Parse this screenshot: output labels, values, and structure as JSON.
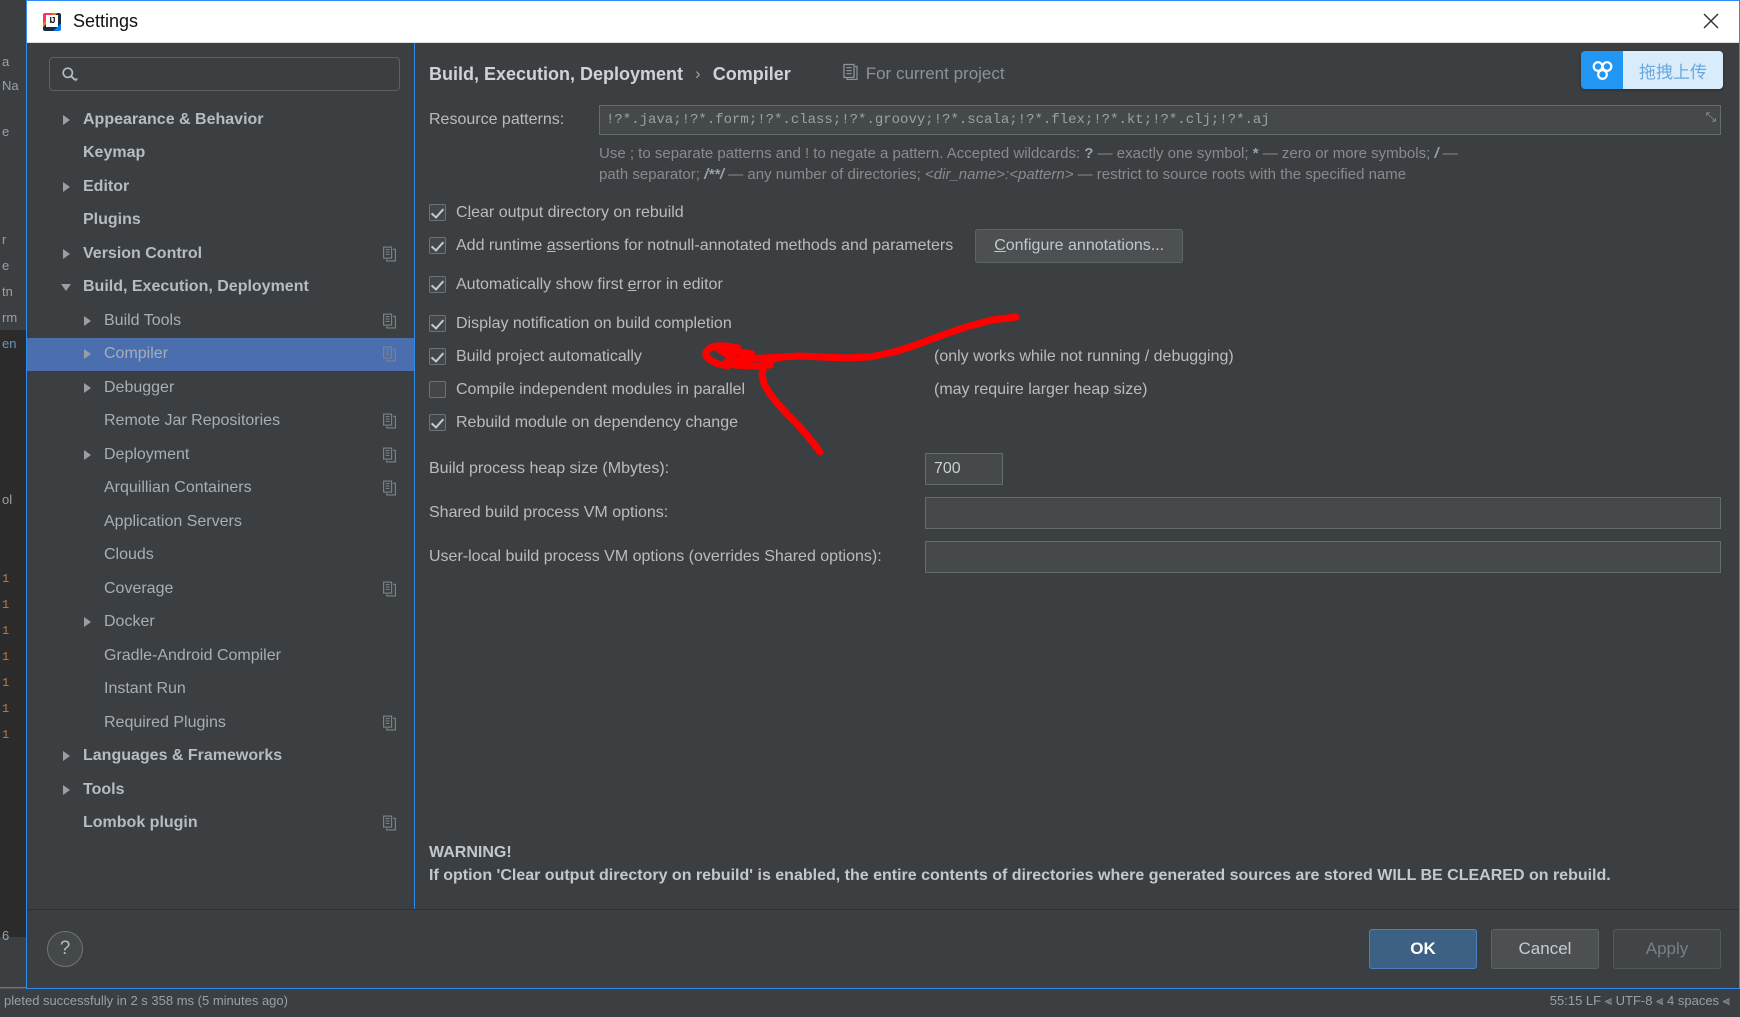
{
  "window": {
    "title": "Settings",
    "app_icon": "intellij-idea-icon",
    "close_icon": "close-icon"
  },
  "search": {
    "icon": "search-icon",
    "value": "",
    "placeholder": ""
  },
  "sidebar": {
    "items": [
      {
        "label": "Appearance & Behavior",
        "level": 0,
        "arrow": "right",
        "selected": false,
        "copy_icon": false
      },
      {
        "label": "Keymap",
        "level": 0,
        "arrow": "none",
        "selected": false,
        "copy_icon": false
      },
      {
        "label": "Editor",
        "level": 0,
        "arrow": "right",
        "selected": false,
        "copy_icon": false
      },
      {
        "label": "Plugins",
        "level": 0,
        "arrow": "none",
        "selected": false,
        "copy_icon": false
      },
      {
        "label": "Version Control",
        "level": 0,
        "arrow": "right",
        "selected": false,
        "copy_icon": true
      },
      {
        "label": "Build, Execution, Deployment",
        "level": 0,
        "arrow": "down",
        "selected": false,
        "copy_icon": false
      },
      {
        "label": "Build Tools",
        "level": 1,
        "arrow": "right",
        "selected": false,
        "copy_icon": true
      },
      {
        "label": "Compiler",
        "level": 1,
        "arrow": "right",
        "selected": true,
        "copy_icon": true
      },
      {
        "label": "Debugger",
        "level": 1,
        "arrow": "right",
        "selected": false,
        "copy_icon": false
      },
      {
        "label": "Remote Jar Repositories",
        "level": 1,
        "arrow": "none",
        "selected": false,
        "copy_icon": true
      },
      {
        "label": "Deployment",
        "level": 1,
        "arrow": "right",
        "selected": false,
        "copy_icon": true
      },
      {
        "label": "Arquillian Containers",
        "level": 1,
        "arrow": "none",
        "selected": false,
        "copy_icon": true
      },
      {
        "label": "Application Servers",
        "level": 1,
        "arrow": "none",
        "selected": false,
        "copy_icon": false
      },
      {
        "label": "Clouds",
        "level": 1,
        "arrow": "none",
        "selected": false,
        "copy_icon": false
      },
      {
        "label": "Coverage",
        "level": 1,
        "arrow": "none",
        "selected": false,
        "copy_icon": true
      },
      {
        "label": "Docker",
        "level": 1,
        "arrow": "right",
        "selected": false,
        "copy_icon": false
      },
      {
        "label": "Gradle-Android Compiler",
        "level": 1,
        "arrow": "none",
        "selected": false,
        "copy_icon": false
      },
      {
        "label": "Instant Run",
        "level": 1,
        "arrow": "none",
        "selected": false,
        "copy_icon": false
      },
      {
        "label": "Required Plugins",
        "level": 1,
        "arrow": "none",
        "selected": false,
        "copy_icon": true
      },
      {
        "label": "Languages & Frameworks",
        "level": 0,
        "arrow": "right",
        "selected": false,
        "copy_icon": false
      },
      {
        "label": "Tools",
        "level": 0,
        "arrow": "right",
        "selected": false,
        "copy_icon": false
      },
      {
        "label": "Lombok plugin",
        "level": 0,
        "arrow": "none",
        "selected": false,
        "copy_icon": true
      }
    ]
  },
  "header": {
    "breadcrumb_parent": "Build, Execution, Deployment",
    "breadcrumb_separator": "›",
    "breadcrumb_current": "Compiler",
    "scope_icon": "project-scope-icon",
    "scope_label": "For current project"
  },
  "badge": {
    "icon": "drag-upload-icon",
    "label": "拖拽上传",
    "icon_bg": "#2196f3",
    "text_bg": "#d9ecfb",
    "text_color": "#6aa9dd"
  },
  "form": {
    "resource_patterns_label": "Resource patterns:",
    "resource_patterns_value": "!?*.java;!?*.form;!?*.class;!?*.groovy;!?*.scala;!?*.flex;!?*.kt;!?*.clj;!?*.aj",
    "resource_patterns_expand_icon": "expand-icon",
    "hint_line1_a": "Use ; to separate patterns and ! to negate a pattern. Accepted wildcards: ",
    "hint_line1_q": "?",
    "hint_line1_b": " — exactly one symbol; ",
    "hint_line1_star": "*",
    "hint_line1_c": " — zero or more symbols; ",
    "hint_line1_slash": "/",
    "hint_line1_d": " —",
    "hint_line2_a": "path separator; ",
    "hint_line2_globstar": "/**/",
    "hint_line2_b": " — any number of directories;  ",
    "hint_line2_dirname": "<dir_name>:<pattern>",
    "hint_line2_c": " — restrict to source roots with the specified name",
    "checkboxes": [
      {
        "label_pre": "C",
        "label_mnemonic": "l",
        "label_post": "ear output directory on rebuild",
        "checked": true,
        "note": "",
        "button": ""
      },
      {
        "label_pre": "Add runtime ",
        "label_mnemonic": "a",
        "label_post": "ssertions for notnull-annotated methods and parameters",
        "checked": true,
        "note": "",
        "button": "Configure annotations..."
      },
      {
        "label_pre": "Automatically show first ",
        "label_mnemonic": "e",
        "label_post": "rror in editor",
        "checked": true,
        "note": "",
        "button": ""
      },
      {
        "label_pre": "Display notification on build completion",
        "label_mnemonic": "",
        "label_post": "",
        "checked": true,
        "note": "",
        "button": ""
      },
      {
        "label_pre": "Build project automatically",
        "label_mnemonic": "",
        "label_post": "",
        "checked": true,
        "note": "(only works while not running / debugging)",
        "button": ""
      },
      {
        "label_pre": "Compile independent modules in parallel",
        "label_mnemonic": "",
        "label_post": "",
        "checked": false,
        "note": "(may require larger heap size)",
        "button": ""
      },
      {
        "label_pre": "Rebuild module on dependency change",
        "label_mnemonic": "",
        "label_post": "",
        "checked": true,
        "note": "",
        "button": ""
      }
    ],
    "configure_annotations_mnemonic": "C",
    "configure_annotations_rest": "onfigure annotations...",
    "heap_label": "Build process heap size (Mbytes):",
    "heap_value": "700",
    "shared_vm_label": "Shared build process VM options:",
    "shared_vm_value": "",
    "userlocal_vm_label": "User-local build process VM options (overrides Shared options):",
    "userlocal_vm_value": "",
    "warning_title": "WARNING!",
    "warning_body": "If option 'Clear output directory on rebuild' is enabled, the entire contents of directories where generated sources are stored WILL BE CLEARED on rebuild."
  },
  "footer": {
    "help_label": "?",
    "ok_label": "OK",
    "cancel_label": "Cancel",
    "apply_label": "Apply"
  },
  "backdrop": {
    "status_left": "pleted successfully in 2 s 358 ms (5 minutes ago)",
    "status_right": "55:15   LF ⫷   UTF-8 ⫷   4 spaces ⫷",
    "ghost_left_labels": [
      "a",
      "Na",
      "e",
      "r",
      "e",
      "tn",
      "rm",
      "en",
      "ol"
    ]
  },
  "colors": {
    "dialog_bg": "#3c3f41",
    "selection_blue": "#4b6eaf",
    "accent_border": "#2d8cf0",
    "annotation_red": "#ff0000",
    "primary_button": "#3d6185"
  }
}
